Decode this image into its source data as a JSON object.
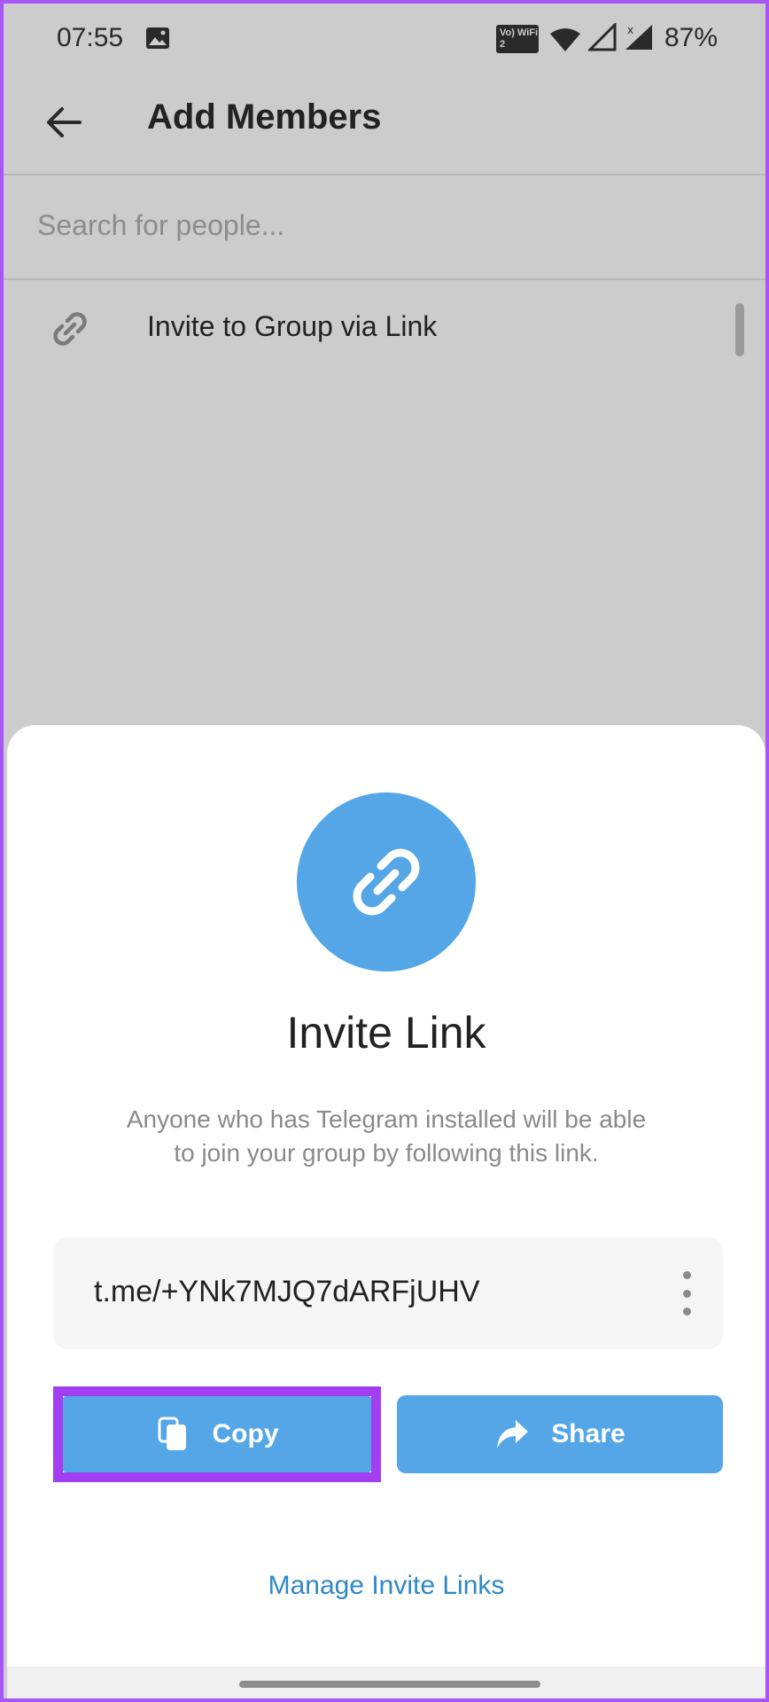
{
  "status_bar": {
    "time": "07:55",
    "volte_label": "Vo) WiFi 2",
    "battery": "87%"
  },
  "header": {
    "title": "Add Members"
  },
  "search": {
    "placeholder": "Search for people..."
  },
  "invite_row": {
    "label": "Invite to Group via Link"
  },
  "sheet": {
    "title": "Invite Link",
    "description": "Anyone who has Telegram installed will be able to join your group by following this link.",
    "link": "t.me/+YNk7MJQ7dARFjUHV",
    "copy_label": "Copy",
    "share_label": "Share",
    "manage_label": "Manage Invite Links"
  },
  "colors": {
    "accent": "#54a6e7",
    "link_text": "#2f88c8",
    "highlight": "#a13ff0",
    "dim_background": "#cccccc"
  },
  "icons": [
    "gallery-icon",
    "wifi-icon",
    "signal-icon",
    "back-arrow-icon",
    "link-icon",
    "more-vertical-icon",
    "copy-icon",
    "share-icon"
  ]
}
